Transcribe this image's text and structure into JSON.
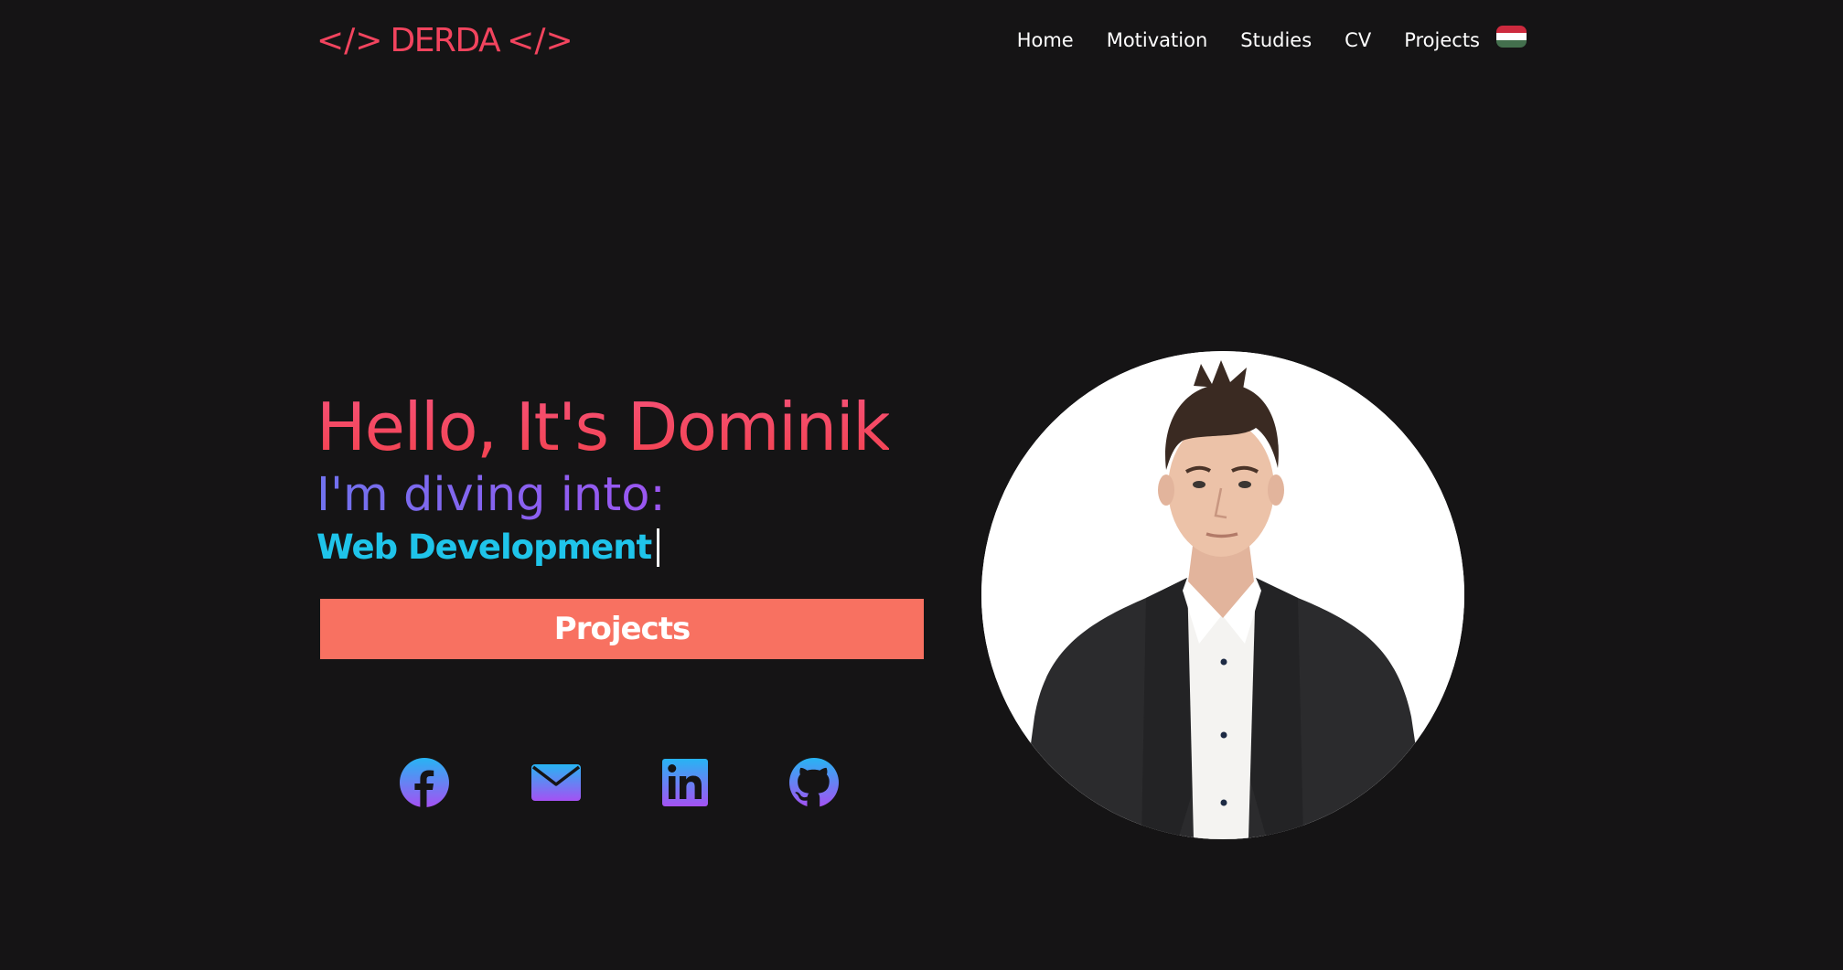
{
  "header": {
    "logo": {
      "left_tag": "</>",
      "name": "DERDA",
      "right_tag": "</>"
    },
    "nav": [
      {
        "label": "Home"
      },
      {
        "label": "Motivation"
      },
      {
        "label": "Studies"
      },
      {
        "label": "CV"
      },
      {
        "label": "Projects"
      }
    ],
    "language_flag": {
      "icon": "hungarian-flag-icon",
      "colors": [
        "#cd2a3e",
        "#ffffff",
        "#436f4d"
      ]
    }
  },
  "hero": {
    "title": "Hello, It's Dominik",
    "subtitle": "I'm diving into:",
    "typing_text": "Web Development",
    "cta_label": "Projects",
    "socials": [
      {
        "icon": "facebook-icon"
      },
      {
        "icon": "mail-icon"
      },
      {
        "icon": "linkedin-icon"
      },
      {
        "icon": "github-icon"
      }
    ],
    "portrait": {
      "icon": "profile-photo"
    }
  },
  "colors": {
    "background": "#151415",
    "accent_red": "#f2445e",
    "accent_purple": "#8a5cf0",
    "accent_cyan": "#1fc4ea",
    "button": "#f87161"
  }
}
